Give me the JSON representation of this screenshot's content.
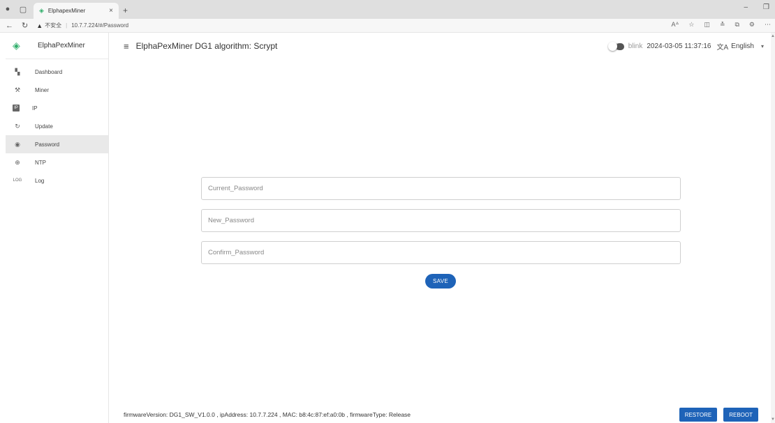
{
  "browser": {
    "tab_title": "ElphapexMiner",
    "tab_close": "×",
    "new_tab": "+",
    "insecure_label": "不安全",
    "url": "10.7.7.224/#/Password"
  },
  "app": {
    "brand_name": "ElphaPexMiner",
    "header_title": "ElphaPexMiner DG1 algorithm: Scrypt",
    "blink_label": "blink",
    "datetime": "2024-03-05 11:37:16",
    "language": "English"
  },
  "sidebar": {
    "items": [
      {
        "label": "Dashboard",
        "icon": "dashboard-icon",
        "glyph": "▚"
      },
      {
        "label": "Miner",
        "icon": "miner-icon",
        "glyph": "⚒"
      },
      {
        "label": "IP",
        "icon": "ip-icon",
        "glyph": "IP"
      },
      {
        "label": "Update",
        "icon": "update-icon",
        "glyph": "↻"
      },
      {
        "label": "Password",
        "icon": "password-icon",
        "glyph": "◉"
      },
      {
        "label": "NTP",
        "icon": "ntp-icon",
        "glyph": "⊕"
      },
      {
        "label": "Log",
        "icon": "log-icon",
        "glyph": "LOG"
      }
    ]
  },
  "form": {
    "current_password_placeholder": "Current_Password",
    "new_password_placeholder": "New_Password",
    "confirm_password_placeholder": "Confirm_Password",
    "save_label": "SAVE"
  },
  "footer": {
    "info": "firmwareVersion: DG1_SW_V1.0.0 , ipAddress: 10.7.7.224 , MAC: b8:4c:87:ef:a0:0b , firmwareType: Release",
    "restore_label": "RESTORE",
    "reboot_label": "REBOOT"
  },
  "colors": {
    "accent": "#1e63b8",
    "brand": "#2fae6a"
  }
}
